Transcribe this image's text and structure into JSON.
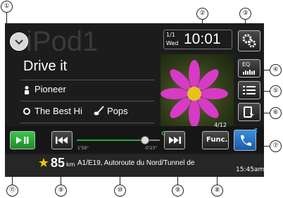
{
  "callouts": [
    "①",
    "②",
    "③",
    "④",
    "⑤",
    "⑥",
    "⑦",
    "⑧",
    "⑨",
    "⑩",
    "⑨",
    "⑪"
  ],
  "header": {
    "source_watermark": "iPod1",
    "date_top": "1/1",
    "date_day": "Wed",
    "time": "10:01"
  },
  "track": {
    "title": "Drive it",
    "artist": "Pioneer",
    "album": "The Best Hi",
    "genre": "Pops"
  },
  "eq_button": {
    "label": "EQ"
  },
  "progress": {
    "elapsed": "1'59\"",
    "remaining": "-0'23\"",
    "fraction": 0.82,
    "track_number": "4/12"
  },
  "func_button": {
    "label": "Func."
  },
  "status": {
    "odometer": "85",
    "odometer_unit": "km",
    "road": "A1/E19, Autoroute du Nord/Tunnel de",
    "clock": "15:45am"
  },
  "colors": {
    "accent": "#2a9df4",
    "play_green": "#2aaa3a",
    "call_blue": "#2a7cd0",
    "text": "#ffffff",
    "star": "#f2c400"
  },
  "icons": [
    "chevron-down-icon",
    "settings-gears-icon",
    "list-icon",
    "device-icon",
    "play-pause-icon",
    "previous-track-icon",
    "next-track-icon",
    "phone-icon",
    "person-icon",
    "disc-icon",
    "guitar-icon",
    "star-icon",
    "bluetooth-icon",
    "repeat-icon"
  ]
}
